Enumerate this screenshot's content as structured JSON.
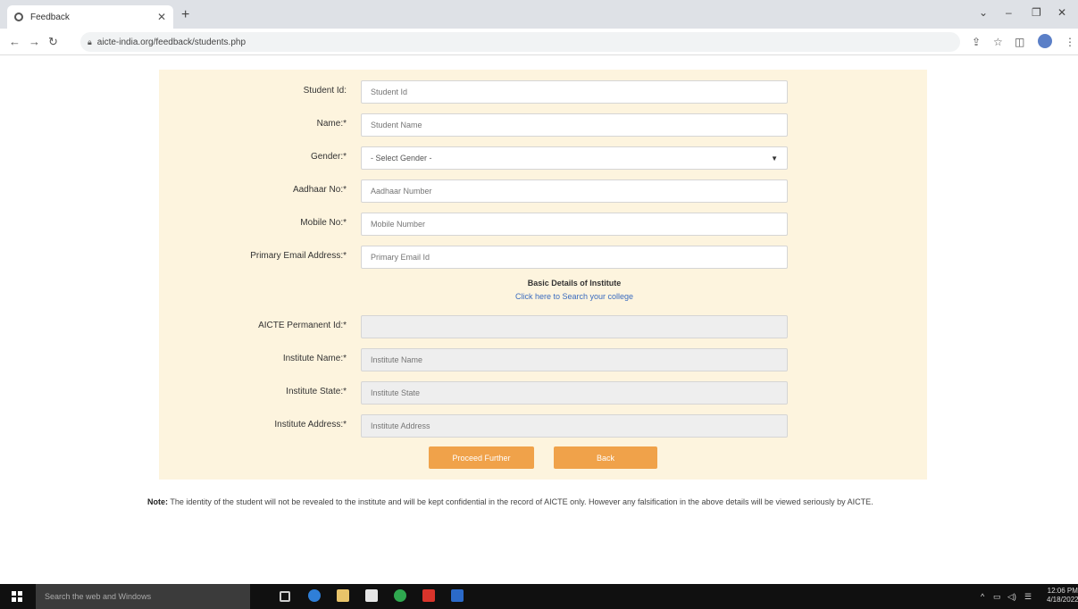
{
  "browser": {
    "tab_title": "Feedback",
    "url": "aicte-india.org/feedback/students.php"
  },
  "form": {
    "fields": [
      {
        "label": "Student Id:",
        "placeholder": "Student Id"
      },
      {
        "label": "Name:*",
        "placeholder": "Student Name"
      },
      {
        "label": "Gender:*",
        "value": "- Select Gender -"
      },
      {
        "label": "Aadhaar No:*",
        "placeholder": "Aadhaar Number"
      },
      {
        "label": "Mobile No:*",
        "placeholder": "Mobile Number"
      },
      {
        "label": "Primary Email Address:*",
        "placeholder": "Primary Email Id"
      }
    ],
    "section_title": "Basic Details of Institute",
    "section_link": "Click here to Search your college",
    "institute_fields": [
      {
        "label": "AICTE Permanent Id:*",
        "placeholder": ""
      },
      {
        "label": "Institute Name:*",
        "placeholder": "Institute Name"
      },
      {
        "label": "Institute State:*",
        "placeholder": "Institute State"
      },
      {
        "label": "Institute Address:*",
        "placeholder": "Institute Address"
      }
    ],
    "proceed_label": "Proceed Further",
    "back_label": "Back"
  },
  "note": {
    "heading": "Note:",
    "text": "The identity of the student will not be revealed to the institute and will be kept confidential in the record of AICTE only. However any falsification in the above details will be viewed seriously by AICTE."
  },
  "taskbar": {
    "search_placeholder": "Search the web and Windows",
    "time": "12:06 PM",
    "date": "4/18/2022"
  },
  "colors": {
    "panel_bg": "#fdf4de",
    "button": "#f0a24a",
    "link": "#3a6bbf"
  }
}
